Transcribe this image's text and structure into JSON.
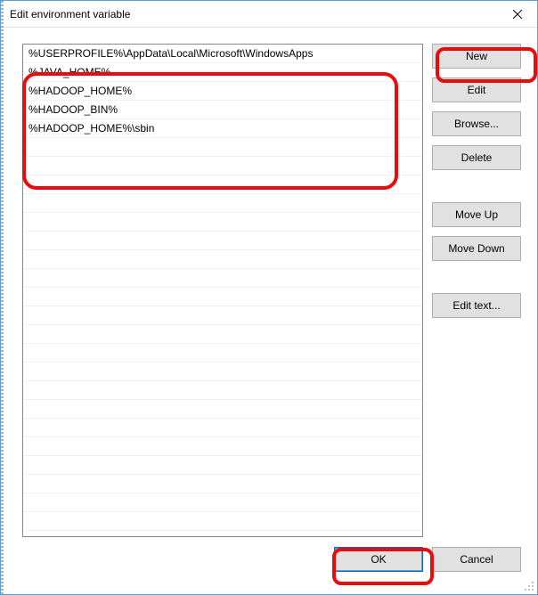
{
  "window": {
    "title": "Edit environment variable"
  },
  "list": {
    "items": [
      "%USERPROFILE%\\AppData\\Local\\Microsoft\\WindowsApps",
      "%JAVA_HOME%",
      "%HADOOP_HOME%",
      "%HADOOP_BIN%",
      "%HADOOP_HOME%\\sbin"
    ]
  },
  "buttons": {
    "new": "New",
    "edit": "Edit",
    "browse": "Browse...",
    "delete": "Delete",
    "move_up": "Move Up",
    "move_down": "Move Down",
    "edit_text": "Edit text...",
    "ok": "OK",
    "cancel": "Cancel"
  }
}
